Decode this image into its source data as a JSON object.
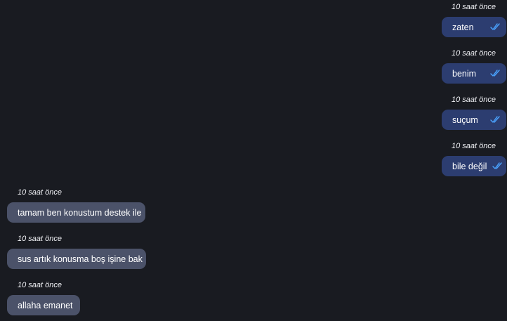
{
  "messages": [
    {
      "direction": "sent",
      "time": "10 saat önce",
      "text": "zaten",
      "status_icon": "double-check-icon"
    },
    {
      "direction": "sent",
      "time": "10 saat önce",
      "text": "benim",
      "status_icon": "double-check-icon"
    },
    {
      "direction": "sent",
      "time": "10 saat önce",
      "text": "suçum",
      "status_icon": "double-check-icon"
    },
    {
      "direction": "sent",
      "time": "10 saat önce",
      "text": "bile değil",
      "status_icon": "double-check-icon"
    },
    {
      "direction": "received",
      "time": "10 saat önce",
      "text": "tamam ben konustum destek ile"
    },
    {
      "direction": "received",
      "time": "10 saat önce",
      "text": "sus artık konusma boş işine bak"
    },
    {
      "direction": "received",
      "time": "10 saat önce",
      "text": "allaha emanet"
    }
  ],
  "colors": {
    "background": "#191b21",
    "sent_bubble": "#2c3d70",
    "received_bubble": "#4b5269",
    "read_check": "#4aa3ff",
    "text": "#ffffff"
  }
}
